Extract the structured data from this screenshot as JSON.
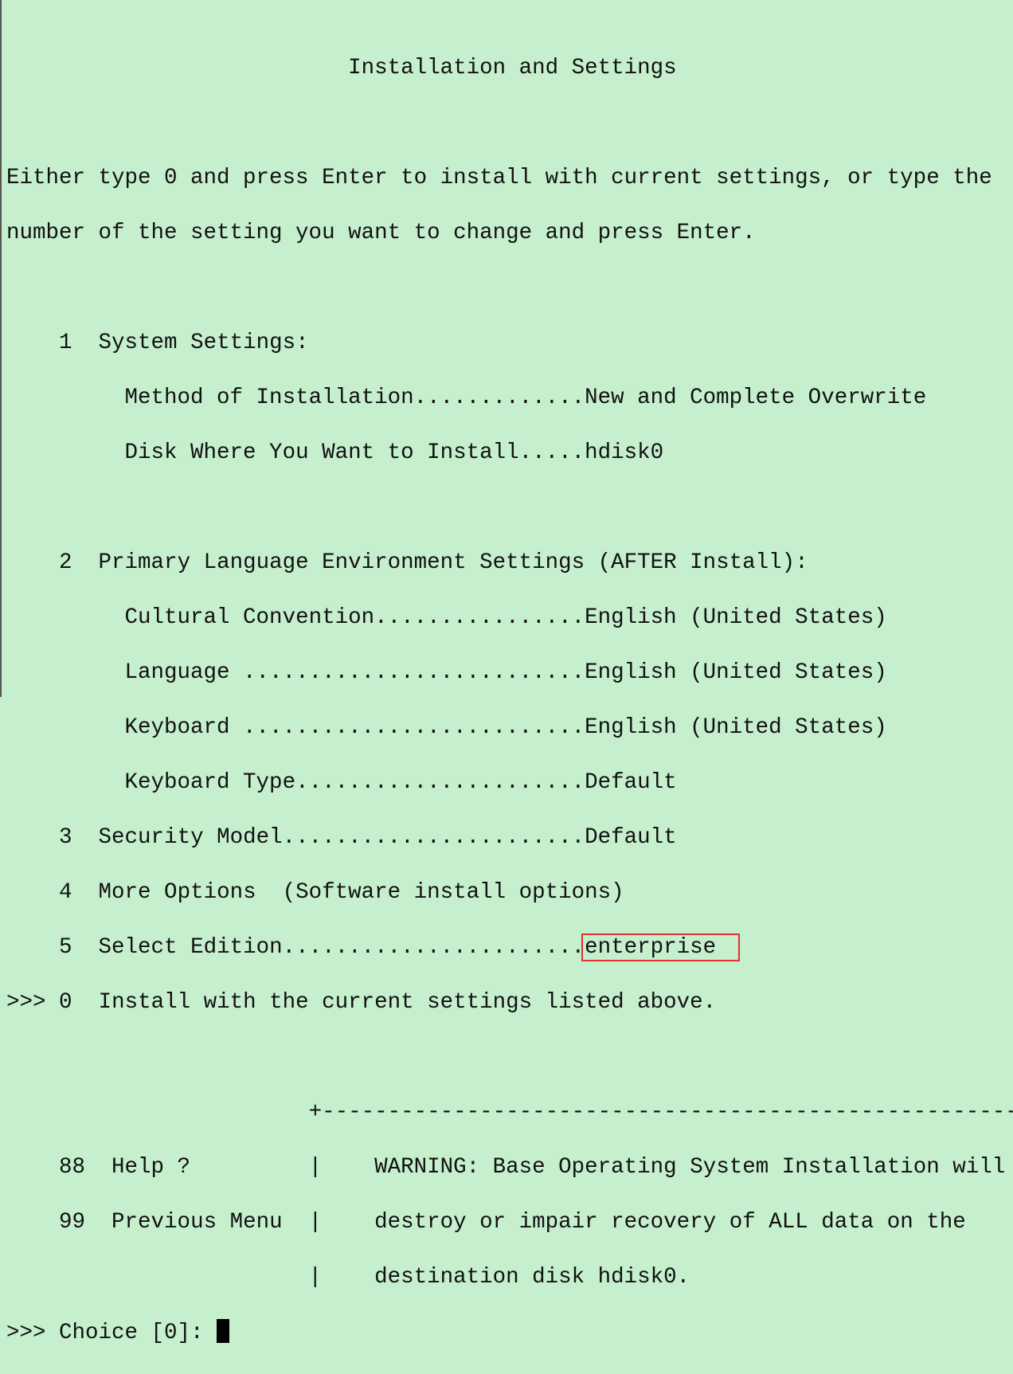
{
  "title": "Installation and Settings",
  "instructions": [
    "Either type 0 and press Enter to install with current settings, or type the",
    "number of the setting you want to change and press Enter."
  ],
  "settings": {
    "s1": {
      "num": "1",
      "label": "System Settings:",
      "method_label": "Method of Installation.............",
      "method_value": "New and Complete Overwrite",
      "disk_label": "Disk Where You Want to Install.....",
      "disk_value": "hdisk0"
    },
    "s2": {
      "num": "2",
      "label": "Primary Language Environment Settings (AFTER Install):",
      "cultural_label": "Cultural Convention................",
      "cultural_value": "English (United States)",
      "language_label": "Language ..........................",
      "language_value": "English (United States)",
      "keyboard_label": "Keyboard ..........................",
      "keyboard_value": "English (United States)",
      "kbtype_label": "Keyboard Type......................",
      "kbtype_value": "Default"
    },
    "s3": {
      "num": "3",
      "label": "Security Model.......................",
      "value": "Default"
    },
    "s4": {
      "num": "4",
      "label": "More Options  (Software install options)"
    },
    "s5": {
      "num": "5",
      "label": "Select Edition.......................",
      "value": "enterprise"
    },
    "s0": {
      "marker": ">>>",
      "num": "0",
      "label": "Install with the current settings listed above."
    }
  },
  "highlight_color": "#e03030",
  "footer": {
    "divider": "+-------------------------------------------------------",
    "help": {
      "num": "88",
      "label": "Help ?"
    },
    "previous": {
      "num": "99",
      "label": "Previous Menu"
    },
    "warning": [
      "WARNING: Base Operating System Installation will",
      "destroy or impair recovery of ALL data on the",
      "destination disk hdisk0."
    ],
    "prompt": ">>> Choice [0]: "
  }
}
